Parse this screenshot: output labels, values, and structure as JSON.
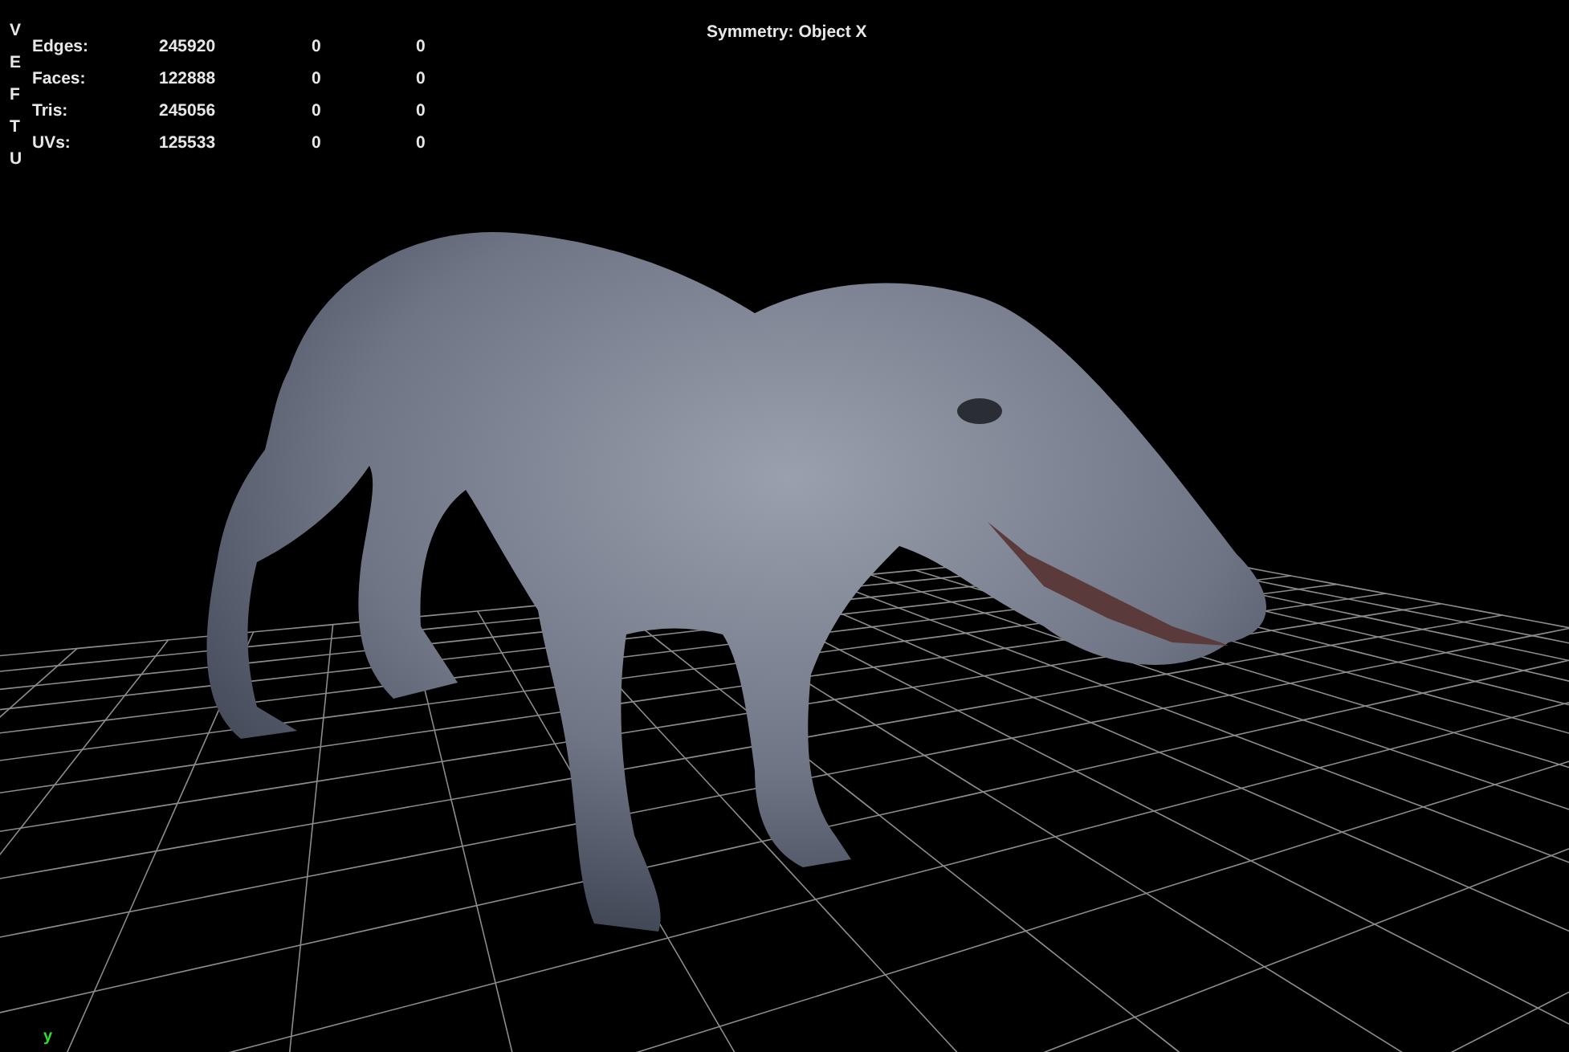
{
  "viewport": {
    "heads_cut": [
      "V",
      "E",
      "F",
      "T",
      "U"
    ],
    "poly_count": [
      {
        "label": "Edges:",
        "values": [
          "245920",
          "0",
          "0"
        ]
      },
      {
        "label": "Faces:",
        "values": [
          "122888",
          "0",
          "0"
        ]
      },
      {
        "label": "Tris:",
        "values": [
          "245056",
          "0",
          "0"
        ]
      },
      {
        "label": "UVs:",
        "values": [
          "125533",
          "0",
          "0"
        ]
      }
    ],
    "symmetry": "Symmetry: Object X",
    "axis_label": "y"
  }
}
